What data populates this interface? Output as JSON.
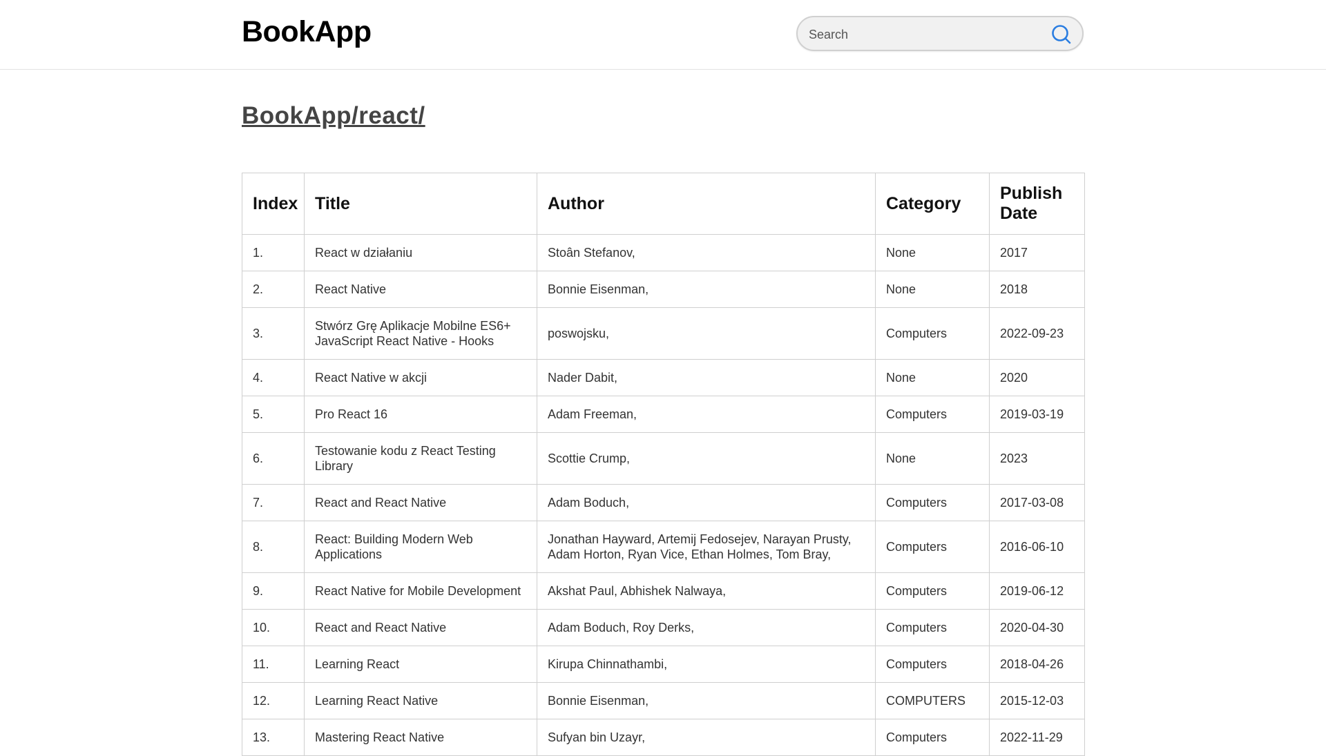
{
  "app": {
    "title": "BookApp"
  },
  "search": {
    "placeholder": "Search",
    "value": ""
  },
  "breadcrumb": "BookApp/react/",
  "table": {
    "headers": {
      "index": "Index",
      "title": "Title",
      "author": "Author",
      "category": "Category",
      "date": "Publish Date"
    },
    "rows": [
      {
        "index": "1.",
        "title": "React w działaniu",
        "author": "Stoân Stefanov,",
        "category": "None",
        "date": "2017"
      },
      {
        "index": "2.",
        "title": "React Native",
        "author": "Bonnie Eisenman,",
        "category": "None",
        "date": "2018"
      },
      {
        "index": "3.",
        "title": "Stwórz Grę Aplikacje Mobilne ES6+ JavaScript React Native - Hooks",
        "author": "poswojsku,",
        "category": "Computers",
        "date": "2022-09-23"
      },
      {
        "index": "4.",
        "title": "React Native w akcji",
        "author": "Nader Dabit,",
        "category": "None",
        "date": "2020"
      },
      {
        "index": "5.",
        "title": "Pro React 16",
        "author": "Adam Freeman,",
        "category": "Computers",
        "date": "2019-03-19"
      },
      {
        "index": "6.",
        "title": "Testowanie kodu z React Testing Library",
        "author": "Scottie Crump,",
        "category": "None",
        "date": "2023"
      },
      {
        "index": "7.",
        "title": "React and React Native",
        "author": "Adam Boduch,",
        "category": "Computers",
        "date": "2017-03-08"
      },
      {
        "index": "8.",
        "title": "React: Building Modern Web Applications",
        "author": "Jonathan Hayward, Artemij Fedosejev, Narayan Prusty, Adam Horton, Ryan Vice, Ethan Holmes, Tom Bray,",
        "category": "Computers",
        "date": "2016-06-10"
      },
      {
        "index": "9.",
        "title": "React Native for Mobile Development",
        "author": "Akshat Paul, Abhishek Nalwaya,",
        "category": "Computers",
        "date": "2019-06-12"
      },
      {
        "index": "10.",
        "title": "React and React Native",
        "author": "Adam Boduch, Roy Derks,",
        "category": "Computers",
        "date": "2020-04-30"
      },
      {
        "index": "11.",
        "title": "Learning React",
        "author": "Kirupa Chinnathambi,",
        "category": "Computers",
        "date": "2018-04-26"
      },
      {
        "index": "12.",
        "title": "Learning React Native",
        "author": "Bonnie Eisenman,",
        "category": "COMPUTERS",
        "date": "2015-12-03"
      },
      {
        "index": "13.",
        "title": "Mastering React Native",
        "author": "Sufyan bin Uzayr,",
        "category": "Computers",
        "date": "2022-11-29"
      }
    ]
  },
  "colors": {
    "search_icon": "#2a7de1",
    "border": "#cfcfcf",
    "breadcrumb": "#444444"
  }
}
